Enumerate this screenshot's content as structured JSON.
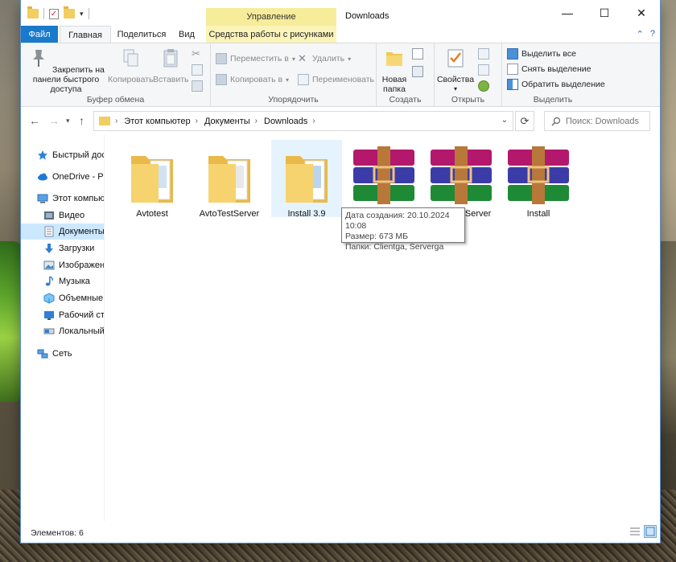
{
  "window": {
    "title": "Downloads",
    "manage_tab": "Управление",
    "controls": {
      "minimize": "—",
      "maximize": "☐",
      "close": "✕"
    }
  },
  "tabs": {
    "file": "Файл",
    "home": "Главная",
    "share": "Поделиться",
    "view": "Вид",
    "picture_tools": "Средства работы с рисунками",
    "help_glyph": "?"
  },
  "ribbon": {
    "clipboard": {
      "label": "Буфер обмена",
      "pin": "Закрепить на панели быстрого доступа",
      "copy": "Копировать",
      "paste": "Вставить"
    },
    "organize": {
      "label": "Упорядочить",
      "move_to": "Переместить в",
      "copy_to": "Копировать в",
      "delete": "Удалить",
      "rename": "Переименовать"
    },
    "new": {
      "label": "Создать",
      "new_folder": "Новая папка"
    },
    "open": {
      "label": "Открыть",
      "properties": "Свойства"
    },
    "select": {
      "label": "Выделить",
      "select_all": "Выделить все",
      "select_none": "Снять выделение",
      "invert": "Обратить выделение"
    }
  },
  "address": {
    "crumbs": [
      "Этот компьютер",
      "Документы",
      "Downloads"
    ],
    "search_placeholder": "Поиск: Downloads"
  },
  "navpane": {
    "items": [
      {
        "label": "Быстрый дост",
        "icon": "star-icon"
      },
      {
        "label": "OneDrive - Per",
        "icon": "cloud-icon"
      },
      {
        "label": "Этот компьют",
        "icon": "computer-icon"
      },
      {
        "label": "Видео",
        "icon": "video-icon"
      },
      {
        "label": "Документы",
        "icon": "documents-icon"
      },
      {
        "label": "Загрузки",
        "icon": "download-icon"
      },
      {
        "label": "Изображени",
        "icon": "pictures-icon"
      },
      {
        "label": "Музыка",
        "icon": "music-icon"
      },
      {
        "label": "Объемные о",
        "icon": "3d-objects-icon"
      },
      {
        "label": "Рабочий сто",
        "icon": "desktop-icon"
      },
      {
        "label": "Локальный ,",
        "icon": "drive-icon"
      },
      {
        "label": "Сеть",
        "icon": "network-icon"
      }
    ],
    "selected": "Документы"
  },
  "files": [
    {
      "name": "Avtotest",
      "type": "folder"
    },
    {
      "name": "AvtoTestServer",
      "type": "folder"
    },
    {
      "name": "Install 3.9",
      "type": "folder"
    },
    {
      "name": "",
      "type": "archive"
    },
    {
      "name": "TestServer",
      "type": "archive"
    },
    {
      "name": "Install",
      "type": "archive"
    }
  ],
  "tooltip": {
    "line1": "Дата создания: 20.10.2024 10:08",
    "line2": "Размер: 673 МБ",
    "line3": "Папки: Clientga, Serverga"
  },
  "status": {
    "items_count": "Элементов: 6"
  },
  "colors": {
    "accent": "#1979ca",
    "manage": "#f7ec9a",
    "selected": "#cce8ff",
    "hover": "#e5f3ff"
  }
}
